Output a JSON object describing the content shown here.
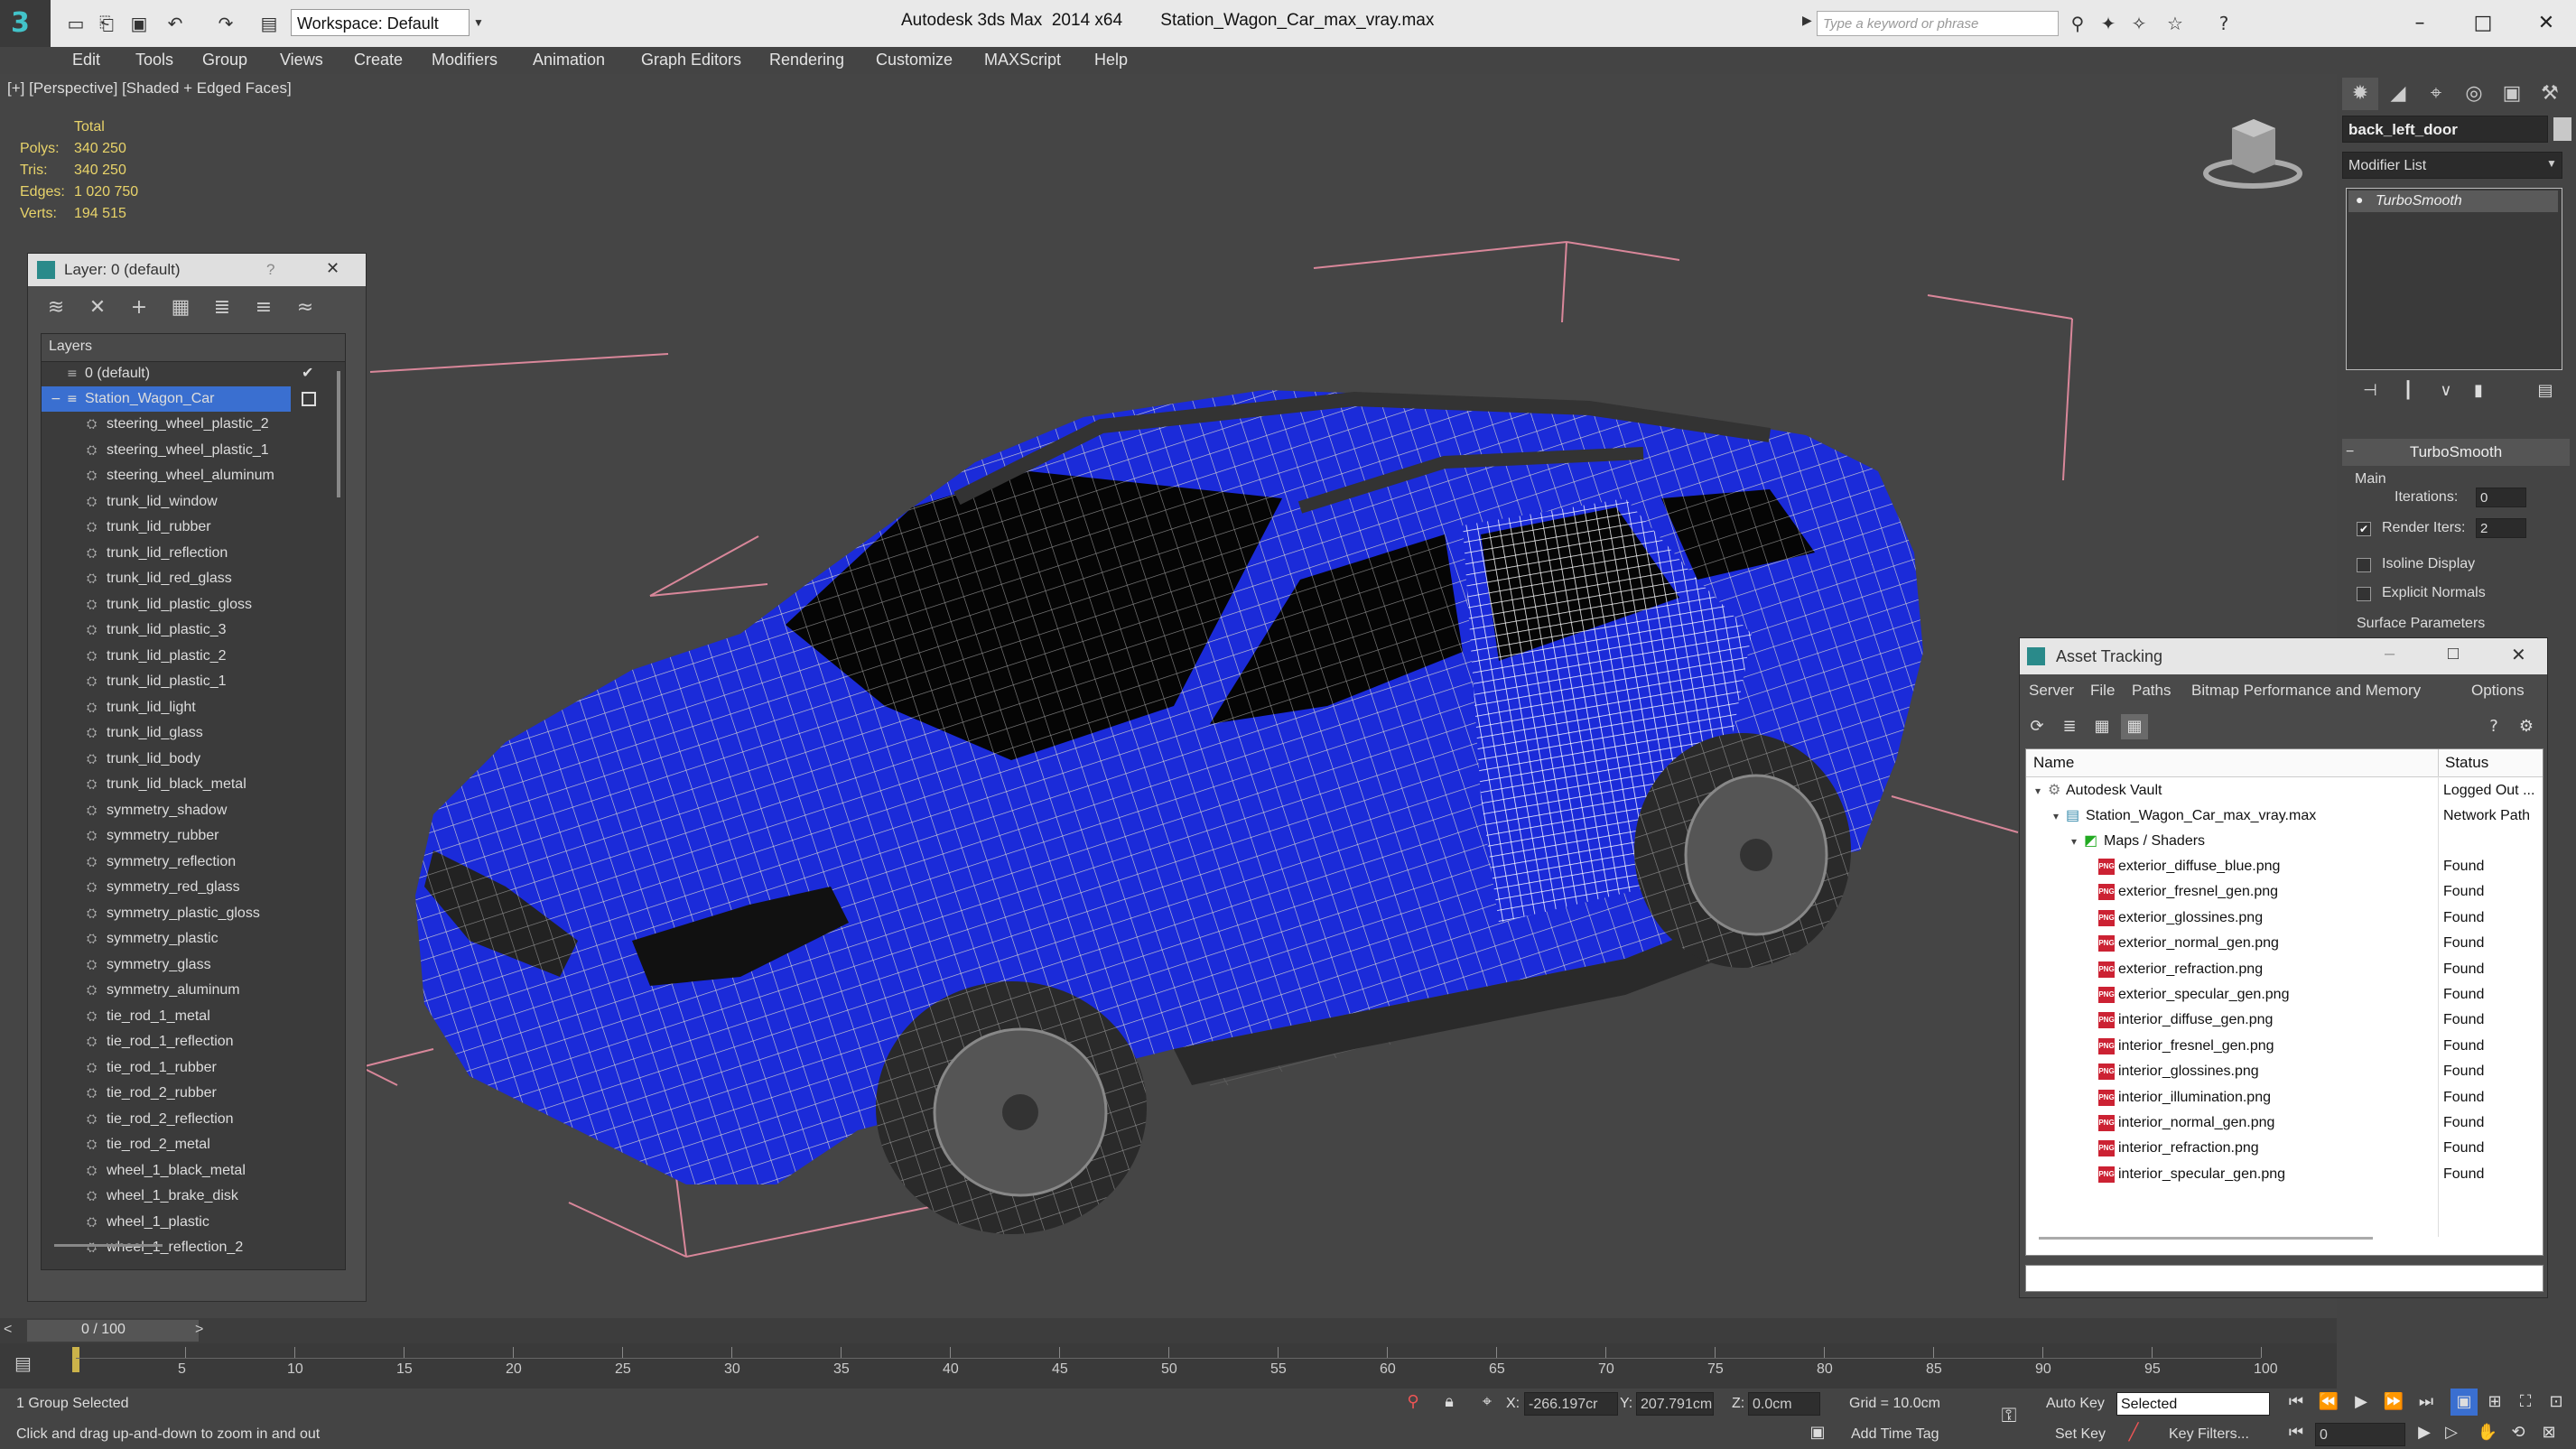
{
  "titlebar": {
    "workspace": "Workspace: Default",
    "app_title": "Autodesk 3ds Max  2014 x64        Station_Wagon_Car_max_vray.max",
    "search_placeholder": "Type a keyword or phrase"
  },
  "menu": [
    "Edit",
    "Tools",
    "Group",
    "Views",
    "Create",
    "Modifiers",
    "Animation",
    "Graph Editors",
    "Rendering",
    "Customize",
    "MAXScript",
    "Help"
  ],
  "viewport": {
    "label": "[+] [Perspective] [Shaded + Edged Faces]",
    "stats": {
      "header": "Total",
      "rows": [
        {
          "label": "Polys:",
          "value": "340 250"
        },
        {
          "label": "Tris:",
          "value": "340 250"
        },
        {
          "label": "Edges:",
          "value": "1 020 750"
        },
        {
          "label": "Verts:",
          "value": "194 515"
        }
      ]
    }
  },
  "layer_panel": {
    "title": "Layer: 0 (default)",
    "help": "?",
    "close": "✕",
    "header": "Layers",
    "default_layer": "0 (default)",
    "selected_layer": "Station_Wagon_Car",
    "objects": [
      "steering_wheel_plastic_2",
      "steering_wheel_plastic_1",
      "steering_wheel_aluminum",
      "trunk_lid_window",
      "trunk_lid_rubber",
      "trunk_lid_reflection",
      "trunk_lid_red_glass",
      "trunk_lid_plastic_gloss",
      "trunk_lid_plastic_3",
      "trunk_lid_plastic_2",
      "trunk_lid_plastic_1",
      "trunk_lid_light",
      "trunk_lid_glass",
      "trunk_lid_body",
      "trunk_lid_black_metal",
      "symmetry_shadow",
      "symmetry_rubber",
      "symmetry_reflection",
      "symmetry_red_glass",
      "symmetry_plastic_gloss",
      "symmetry_plastic",
      "symmetry_glass",
      "symmetry_aluminum",
      "tie_rod_1_metal",
      "tie_rod_1_reflection",
      "tie_rod_1_rubber",
      "tie_rod_2_rubber",
      "tie_rod_2_reflection",
      "tie_rod_2_metal",
      "wheel_1_black_metal",
      "wheel_1_brake_disk",
      "wheel_1_plastic",
      "wheel_1_reflection_2"
    ]
  },
  "command_panel": {
    "object_name": "back_left_door",
    "modifier_list": "Modifier List",
    "modifier": "TurboSmooth",
    "rollout": "TurboSmooth",
    "group_main": "Main",
    "iterations_label": "Iterations:",
    "iterations_value": "0",
    "render_iters_label": "Render Iters:",
    "render_iters_value": "2",
    "isoline_label": "Isoline Display",
    "explicit_normals_label": "Explicit Normals",
    "surface_params": "Surface Parameters"
  },
  "asset_tracking": {
    "title": "Asset Tracking",
    "menu": [
      "Server",
      "File",
      "Paths",
      "Bitmap Performance and Memory",
      "Options"
    ],
    "col_name": "Name",
    "col_status": "Status",
    "vault": {
      "name": "Autodesk Vault",
      "status": "Logged Out ..."
    },
    "file": {
      "name": "Station_Wagon_Car_max_vray.max",
      "status": "Network Path"
    },
    "group": "Maps / Shaders",
    "maps": [
      {
        "name": "exterior_diffuse_blue.png",
        "status": "Found"
      },
      {
        "name": "exterior_fresnel_gen.png",
        "status": "Found"
      },
      {
        "name": "exterior_glossines.png",
        "status": "Found"
      },
      {
        "name": "exterior_normal_gen.png",
        "status": "Found"
      },
      {
        "name": "exterior_refraction.png",
        "status": "Found"
      },
      {
        "name": "exterior_specular_gen.png",
        "status": "Found"
      },
      {
        "name": "interior_diffuse_gen.png",
        "status": "Found"
      },
      {
        "name": "interior_fresnel_gen.png",
        "status": "Found"
      },
      {
        "name": "interior_glossines.png",
        "status": "Found"
      },
      {
        "name": "interior_illumination.png",
        "status": "Found"
      },
      {
        "name": "interior_normal_gen.png",
        "status": "Found"
      },
      {
        "name": "interior_refraction.png",
        "status": "Found"
      },
      {
        "name": "interior_specular_gen.png",
        "status": "Found"
      }
    ]
  },
  "timeline": {
    "frame": "0 / 100",
    "ticks": [
      "5",
      "10",
      "15",
      "20",
      "25",
      "30",
      "35",
      "40",
      "45",
      "50",
      "55",
      "60",
      "65",
      "70",
      "75",
      "80",
      "85",
      "90",
      "95",
      "100"
    ]
  },
  "status": {
    "selection": "1 Group Selected",
    "prompt": "Click and drag up-and-down to zoom in and out",
    "x_label": "X:",
    "x_value": "-266.197cr",
    "y_label": "Y:",
    "y_value": "207.791cm",
    "z_label": "Z:",
    "z_value": "0.0cm",
    "grid": "Grid = 10.0cm",
    "add_time_tag": "Add Time Tag",
    "auto_key": "Auto Key",
    "set_key": "Set Key",
    "key_mode": "Selected",
    "key_filters": "Key Filters...",
    "frame_value": "0"
  },
  "colors": {
    "car_blue": "#1b2bd9",
    "wire": "#c9c9c9",
    "bbox_pink": "#d9879a",
    "stats_yellow": "#e8d36a"
  }
}
